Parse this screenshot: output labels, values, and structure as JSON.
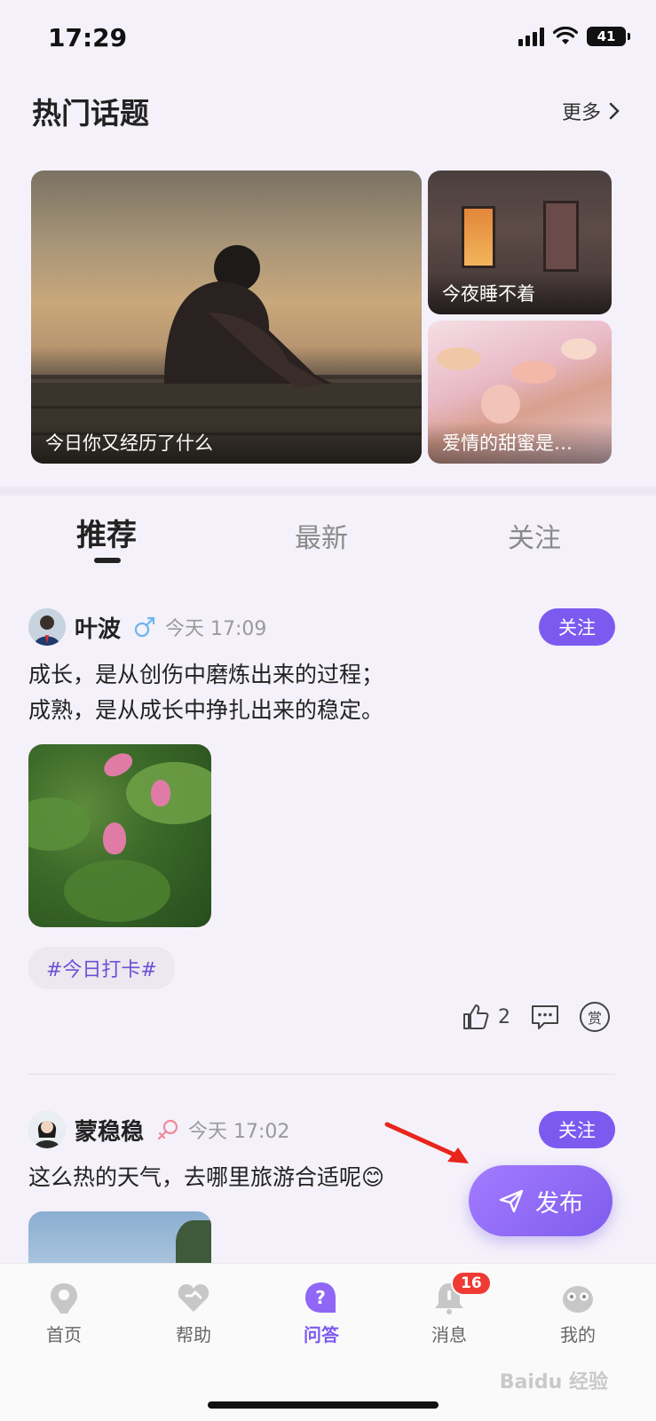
{
  "status_bar": {
    "time": "17:29",
    "battery": "41"
  },
  "hot_topics": {
    "title": "热门话题",
    "more_label": "更多",
    "cards": [
      {
        "label": "今日你又经历了什么"
      },
      {
        "label": "今夜睡不着"
      },
      {
        "label": "爱情的甜蜜是…"
      }
    ]
  },
  "feed_tabs": [
    {
      "label": "推荐"
    },
    {
      "label": "最新"
    },
    {
      "label": "关注"
    }
  ],
  "posts": [
    {
      "author": "叶波",
      "gender": "male",
      "time": "今天 17:09",
      "follow_label": "关注",
      "text_lines": [
        "成长，是从创伤中磨炼出来的过程；",
        "成熟，是从成长中挣扎出来的稳定。"
      ],
      "hashtag": "#今日打卡#",
      "like_count": "2"
    },
    {
      "author": "蒙稳稳",
      "gender": "female",
      "time": "今天 17:02",
      "follow_label": "关注",
      "text": "这么热的天气，去哪里旅游合适呢😊"
    }
  ],
  "actions": {
    "reward_label": "赏"
  },
  "fab": {
    "label": "发布"
  },
  "bottom_nav": [
    {
      "label": "首页",
      "icon": "home-icon"
    },
    {
      "label": "帮助",
      "icon": "help-heart-icon"
    },
    {
      "label": "问答",
      "icon": "qa-icon"
    },
    {
      "label": "消息",
      "icon": "bell-icon",
      "badge": "16"
    },
    {
      "label": "我的",
      "icon": "profile-icon"
    }
  ],
  "watermark": "Baidu 经验",
  "colors": {
    "accent": "#7c5af0",
    "badge": "#ee3b34"
  }
}
